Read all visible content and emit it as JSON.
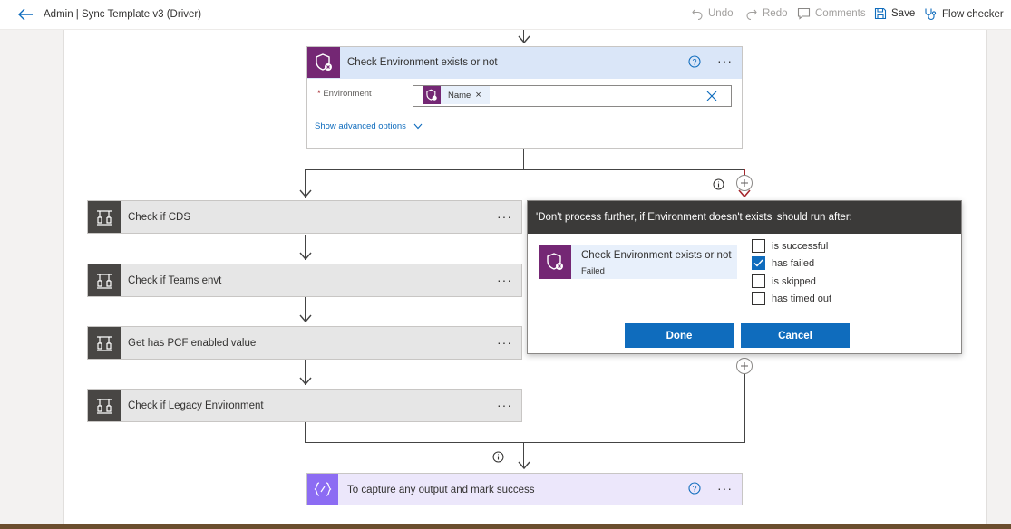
{
  "topbar": {
    "title": "Admin | Sync Template v3 (Driver)",
    "undo_label": "Undo",
    "redo_label": "Redo",
    "comments_label": "Comments",
    "save_label": "Save",
    "flow_checker_label": "Flow checker"
  },
  "top_step": {
    "title": "Check Environment exists or not",
    "environment_label": "Environment",
    "required_mark": "*",
    "token_label": "Name",
    "token_remove": "×",
    "advanced_label": "Show advanced options"
  },
  "left_steps": [
    {
      "title": "Check if CDS"
    },
    {
      "title": "Check if Teams envt"
    },
    {
      "title": "Get has PCF enabled value"
    },
    {
      "title": "Check if Legacy Environment"
    }
  ],
  "run_after_popup": {
    "header": "'Don't process further, if Environment doesn't exists' should run after:",
    "step_title": "Check Environment exists or not",
    "step_status": "Failed",
    "options": [
      {
        "label": "is successful",
        "checked": false
      },
      {
        "label": "has failed",
        "checked": true
      },
      {
        "label": "is skipped",
        "checked": false
      },
      {
        "label": "has timed out",
        "checked": false
      }
    ],
    "done_label": "Done",
    "cancel_label": "Cancel"
  },
  "bottom_step": {
    "title": "To capture any output and mark success"
  },
  "menu_dots": "···",
  "colors": {
    "accent": "#0f6cbd",
    "dataverse_purple": "#742774",
    "compose_violet": "#8c6cf3",
    "step_header_blue": "#dae6f8",
    "control_dark": "#484644",
    "popup_header": "#3b3a39"
  }
}
